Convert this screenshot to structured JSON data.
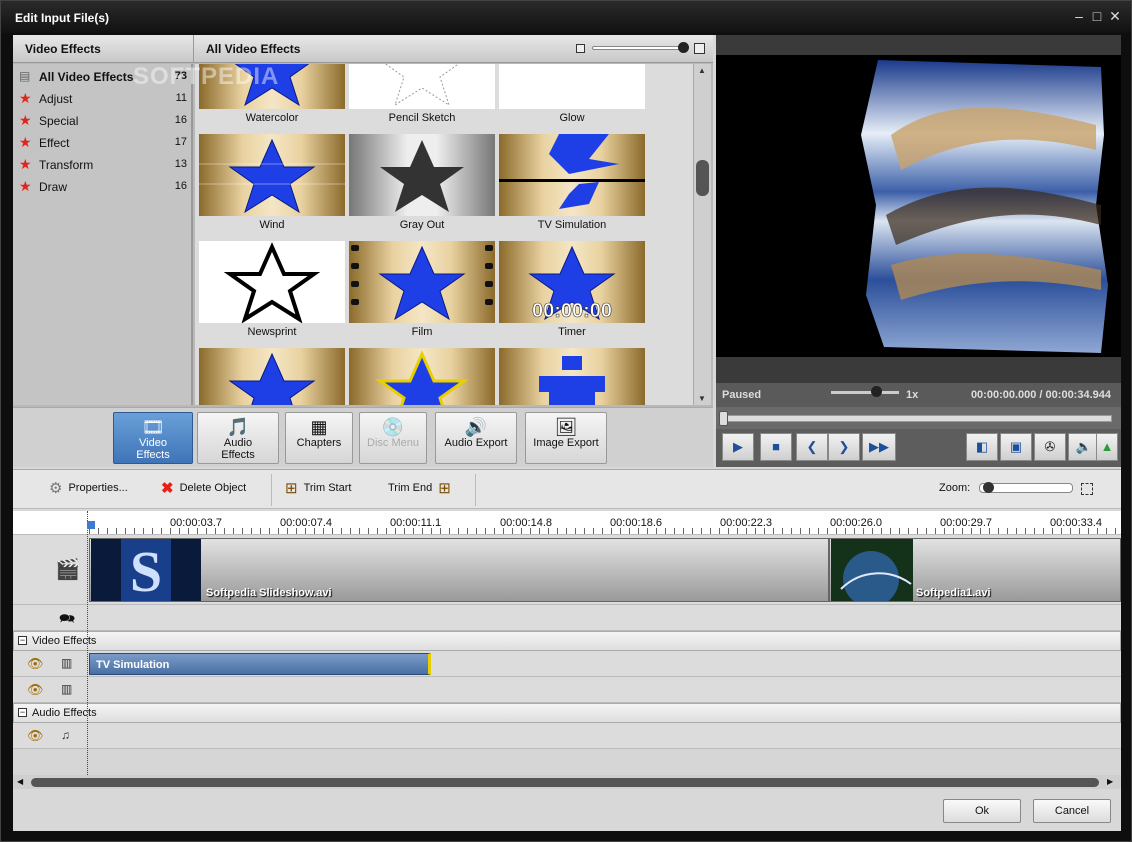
{
  "window": {
    "title": "Edit Input File(s)",
    "min": "–",
    "max": "□",
    "close": "✕"
  },
  "watermark": "SOFTPEDIA",
  "effects_panel": {
    "category_header": "Video Effects",
    "grid_header": "All Video Effects",
    "categories": [
      {
        "label": "All Video Effects",
        "count": "73"
      },
      {
        "label": "Adjust",
        "count": "11"
      },
      {
        "label": "Special",
        "count": "16"
      },
      {
        "label": "Effect",
        "count": "17"
      },
      {
        "label": "Transform",
        "count": "13"
      },
      {
        "label": "Draw",
        "count": "16"
      }
    ],
    "tiles": [
      "Watercolor",
      "Pencil Sketch",
      "Glow",
      "Wind",
      "Gray Out",
      "TV Simulation",
      "Newsprint",
      "Film",
      "Timer",
      "",
      "",
      ""
    ],
    "timer_overlay": "00:00:00"
  },
  "tabs": [
    {
      "label1": "Video",
      "label2": "Effects",
      "icon": "video-effects-icon",
      "state": "active"
    },
    {
      "label1": "Audio",
      "label2": "Effects",
      "icon": "audio-effects-icon",
      "state": "normal"
    },
    {
      "label1": "Chapters",
      "label2": "",
      "icon": "chapters-icon",
      "state": "normal"
    },
    {
      "label1": "Disc Menu",
      "label2": "",
      "icon": "disc-menu-icon",
      "state": "disabled"
    },
    {
      "label1": "Audio Export",
      "label2": "",
      "icon": "audio-export-icon",
      "state": "normal"
    },
    {
      "label1": "Image Export",
      "label2": "",
      "icon": "image-export-icon",
      "state": "normal"
    }
  ],
  "preview": {
    "status": "Paused",
    "rate": "1x",
    "time": "00:00:00.000 / 00:00:34.944"
  },
  "toolbar": {
    "properties": "Properties...",
    "delete": "Delete Object",
    "trim_start": "Trim Start",
    "trim_end": "Trim End",
    "zoom": "Zoom:"
  },
  "ruler": [
    "00:00:03.7",
    "00:00:07.4",
    "00:00:11.1",
    "00:00:14.8",
    "00:00:18.6",
    "00:00:22.3",
    "00:00:26.0",
    "00:00:29.7",
    "00:00:33.4"
  ],
  "timeline": {
    "clips": [
      "Softpedia Slideshow.avi",
      "Softpedia1.avi"
    ],
    "video_effects_header": "Video Effects",
    "audio_effects_header": "Audio Effects",
    "effect_clip": "TV Simulation",
    "collapse_glyph": "−"
  },
  "buttons": {
    "ok": "Ok",
    "cancel": "Cancel"
  },
  "colors": {
    "accent": "#3f74b8",
    "star": "#1f3fe6",
    "effect_border": "#e8d000"
  }
}
